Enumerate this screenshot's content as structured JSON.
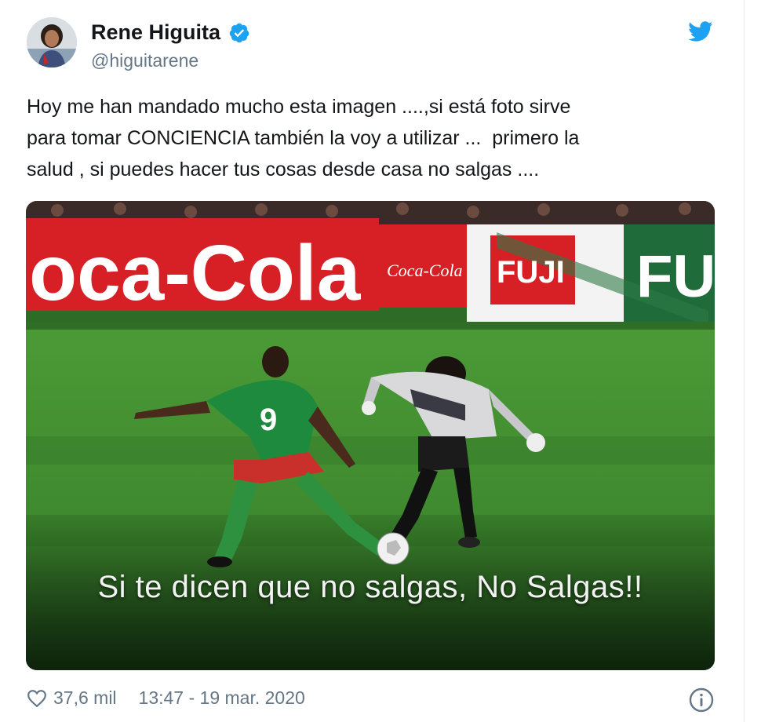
{
  "tweet": {
    "author_name": "Rene Higuita",
    "author_handle": "@higuitarene",
    "text_lines": [
      "Hoy me han mandado mucho esta imagen ....,si está foto sirve",
      "para tomar CONCIENCIA también la voy a utilizar ...  primero la",
      "salud , si puedes hacer tus cosas desde casa no salgas ...."
    ],
    "image": {
      "banner_coca_cola": "oca-Cola",
      "banner_small": "Coca-Cola",
      "banner_fuji": "FUJI",
      "banner_fu": "FU",
      "jersey_number": "9",
      "caption": "Si te dicen que no salgas, No Salgas!!"
    },
    "likes": "37,6 mil",
    "timestamp": "13:47 - 19 mar. 2020"
  },
  "icons": {
    "avatar": "profile-photo",
    "verified": "verified-badge-icon",
    "platform": "twitter-bird-icon",
    "like": "heart-icon",
    "info": "info-icon"
  },
  "colors": {
    "verified_blue": "#1da1f2",
    "twitter_blue": "#1da1f2",
    "text_primary": "#14171a",
    "text_secondary": "#657786",
    "coca_cola_red": "#d71f26",
    "pitch_green": "#3f8a2f"
  }
}
